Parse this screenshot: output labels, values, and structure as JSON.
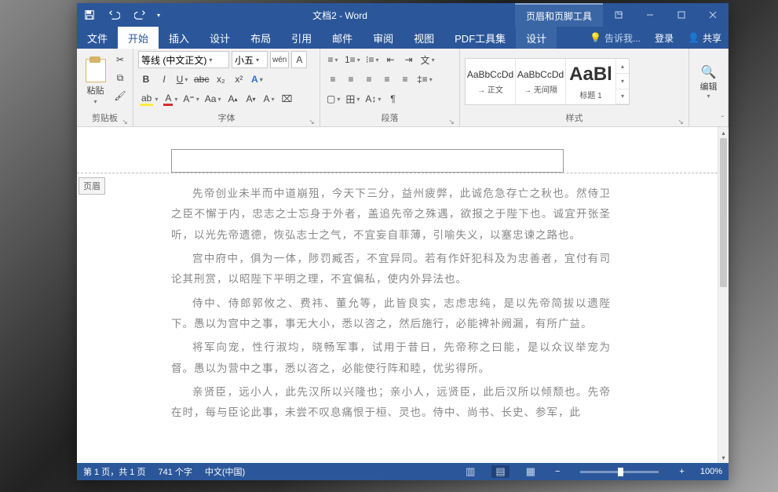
{
  "titlebar": {
    "doc_title": "文档2 - Word",
    "context_title": "页眉和页脚工具"
  },
  "tabs": {
    "file": "文件",
    "home": "开始",
    "insert": "插入",
    "design": "设计",
    "layout": "布局",
    "references": "引用",
    "mailings": "邮件",
    "review": "审阅",
    "view": "视图",
    "pdf": "PDF工具集",
    "context_design": "设计",
    "tell_me": "告诉我...",
    "login": "登录",
    "share": "共享"
  },
  "ribbon": {
    "clipboard": {
      "label": "剪贴板",
      "paste": "粘贴"
    },
    "font": {
      "label": "字体",
      "family": "等线 (中文正文)",
      "size": "小五",
      "phonetic": "wén",
      "clear": "A"
    },
    "paragraph": {
      "label": "段落"
    },
    "styles": {
      "label": "样式",
      "items": [
        {
          "preview": "AaBbCcDd",
          "name": "→ 正文"
        },
        {
          "preview": "AaBbCcDd",
          "name": "→ 无间隔"
        },
        {
          "preview": "AaBl",
          "name": "标题 1"
        }
      ]
    },
    "editing": {
      "label": "编辑"
    }
  },
  "document": {
    "header_tag": "页眉",
    "paragraphs": [
      "先帝创业未半而中道崩殂，今天下三分，益州疲弊，此诚危急存亡之秋也。然侍卫之臣不懈于内，忠志之士忘身于外者，盖追先帝之殊遇，欲报之于陛下也。诚宜开张圣听，以光先帝遗德，恢弘志士之气，不宜妄自菲薄，引喻失义，以塞忠谏之路也。",
      "宫中府中，俱为一体，陟罚臧否，不宜异同。若有作奸犯科及为忠善者，宜付有司论其刑赏，以昭陛下平明之理，不宜偏私，使内外异法也。",
      "侍中、侍郎郭攸之、费祎、董允等，此皆良实，志虑忠纯，是以先帝简拔以遗陛下。愚以为宫中之事，事无大小，悉以咨之，然后施行，必能裨补阙漏，有所广益。",
      "将军向宠，性行淑均，晓畅军事，试用于昔日，先帝称之曰能，是以众议举宠为督。愚以为营中之事，悉以咨之，必能使行阵和睦，优劣得所。",
      "亲贤臣，远小人，此先汉所以兴隆也；亲小人，远贤臣，此后汉所以倾颓也。先帝在时，每与臣论此事，未尝不叹息痛恨于桓、灵也。侍中、尚书、长史、参军，此"
    ]
  },
  "statusbar": {
    "page": "第 1 页，共 1 页",
    "words": "741 个字",
    "lang": "中文(中国)",
    "zoom": "100%"
  }
}
